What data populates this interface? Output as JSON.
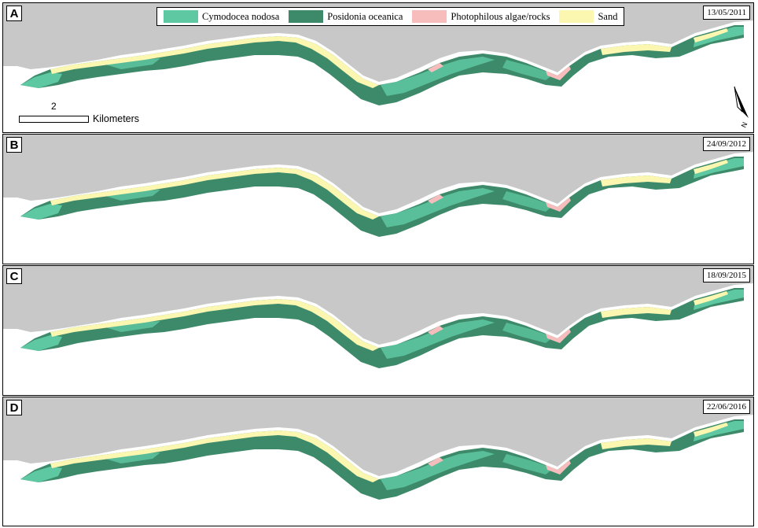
{
  "legend": {
    "items": [
      {
        "label": "Cymodocea nodosa",
        "color": "#5ec8a3"
      },
      {
        "label": "Posidonia oceanica",
        "color": "#3d8a6a"
      },
      {
        "label": "Photophilous algae/rocks",
        "color": "#f7bdbd"
      },
      {
        "label": "Sand",
        "color": "#fbf6b0"
      }
    ]
  },
  "panels": [
    {
      "letter": "A",
      "date": "13/05/2011"
    },
    {
      "letter": "B",
      "date": "24/09/2012"
    },
    {
      "letter": "C",
      "date": "18/09/2015"
    },
    {
      "letter": "D",
      "date": "22/06/2016"
    }
  ],
  "scalebar": {
    "value": "2",
    "unit": "Kilometers"
  },
  "north_arrow": {
    "label": "N",
    "icon": "north-arrow-icon"
  },
  "colors": {
    "land": "#c8c8c8",
    "sea": "#ffffff"
  }
}
